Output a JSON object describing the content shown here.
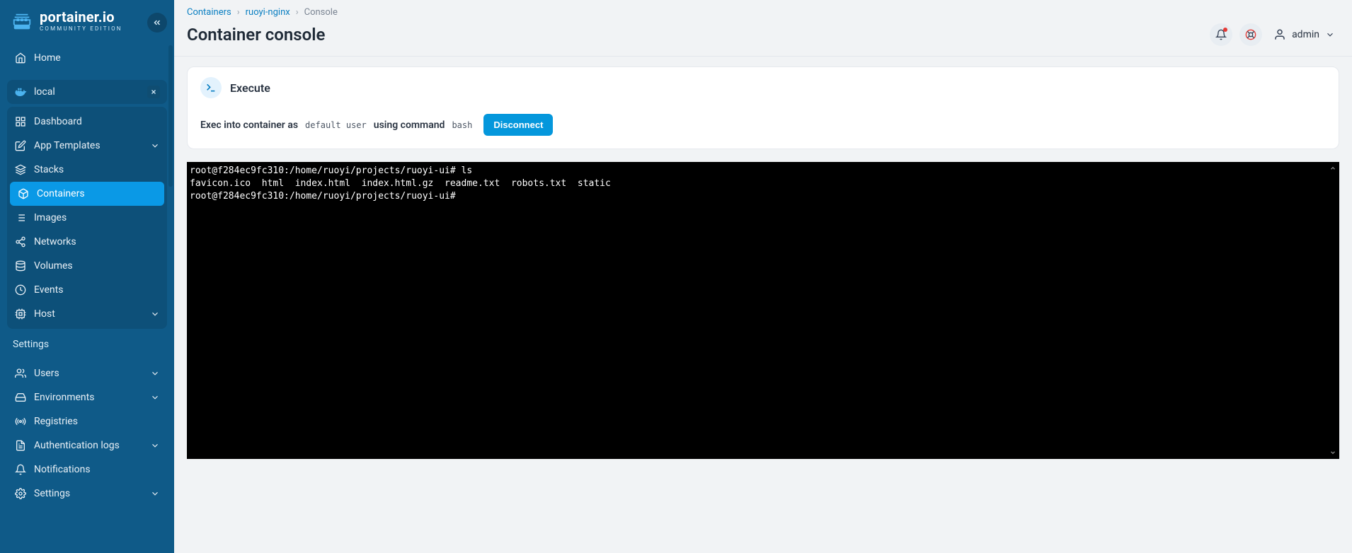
{
  "brand": {
    "name": "portainer.io",
    "edition": "COMMUNITY EDITION"
  },
  "sidebar": {
    "home": "Home",
    "env_name": "local",
    "items": [
      {
        "label": "Dashboard",
        "icon": "grid-icon"
      },
      {
        "label": "App Templates",
        "icon": "edit-icon",
        "expandable": true
      },
      {
        "label": "Stacks",
        "icon": "layers-icon"
      },
      {
        "label": "Containers",
        "icon": "box-icon",
        "active": true
      },
      {
        "label": "Images",
        "icon": "list-icon"
      },
      {
        "label": "Networks",
        "icon": "share-icon"
      },
      {
        "label": "Volumes",
        "icon": "database-icon"
      },
      {
        "label": "Events",
        "icon": "clock-icon"
      },
      {
        "label": "Host",
        "icon": "cpu-icon",
        "expandable": true
      }
    ],
    "settings_heading": "Settings",
    "settings_items": [
      {
        "label": "Users",
        "icon": "users-icon",
        "expandable": true
      },
      {
        "label": "Environments",
        "icon": "hdd-icon",
        "expandable": true
      },
      {
        "label": "Registries",
        "icon": "radio-icon"
      },
      {
        "label": "Authentication logs",
        "icon": "file-icon",
        "expandable": true
      },
      {
        "label": "Notifications",
        "icon": "bell-icon"
      },
      {
        "label": "Settings",
        "icon": "gear-icon",
        "expandable": true
      }
    ]
  },
  "breadcrumb": {
    "l1": "Containers",
    "l2": "ruoyi-nginx",
    "l3": "Console"
  },
  "page": {
    "title": "Container console"
  },
  "user": {
    "name": "admin"
  },
  "card": {
    "title": "Execute",
    "prefix": "Exec into container as",
    "user_value": "default user",
    "mid": "using command",
    "cmd_value": "bash",
    "button": "Disconnect"
  },
  "terminal": {
    "lines": [
      "root@f284ec9fc310:/home/ruoyi/projects/ruoyi-ui# ls",
      "favicon.ico  html  index.html  index.html.gz  readme.txt  robots.txt  static",
      "root@f284ec9fc310:/home/ruoyi/projects/ruoyi-ui# "
    ]
  }
}
